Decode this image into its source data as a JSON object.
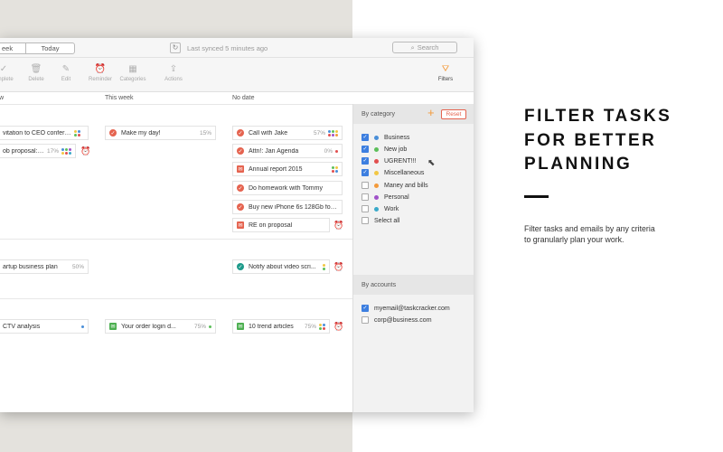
{
  "colors": {
    "accent": "#f39a3b",
    "reset": "#e5634f",
    "check": "#3d7fe0"
  },
  "titlebar": {
    "view_week": "eek",
    "view_today": "Today",
    "sync_icon": "refresh-icon",
    "sync_status": "Last synced 5 minutes ago",
    "search_placeholder": "Search"
  },
  "toolbar": {
    "complete": "omplete",
    "delete": "Delete",
    "edit": "Edit",
    "reminder": "Reminder",
    "categories": "Categories",
    "actions": "Actions",
    "filters": "Filters"
  },
  "columns": {
    "c1": "w",
    "c2": "This week",
    "c3": "No date"
  },
  "cards": [
    {
      "text": "vitation to CEO conference",
      "pct": "",
      "icon": "red"
    },
    {
      "text": "ob proposal: U...",
      "pct": "17%",
      "icon": "red"
    },
    {
      "text": "Make my day!",
      "pct": "15%",
      "icon": "red"
    },
    {
      "text": "Call with Jake",
      "pct": "57%",
      "icon": "red"
    },
    {
      "text": "Attn!: Jan Agenda",
      "pct": "0%",
      "icon": "red"
    },
    {
      "text": "Annual report 2015",
      "pct": "",
      "icon": "mail"
    },
    {
      "text": "Do homework with Tommy",
      "pct": "",
      "icon": "red"
    },
    {
      "text": "Buy new iPhone 6s 128Gb for t...",
      "pct": "",
      "icon": "red"
    },
    {
      "text": "RE on  proposal",
      "pct": "",
      "icon": "mail"
    },
    {
      "text": "artup business plan",
      "pct": "50%",
      "icon": "red"
    },
    {
      "text": "Notify about video scri...",
      "pct": "",
      "icon": "teal"
    },
    {
      "text": "CTV analysis",
      "pct": "",
      "icon": "red"
    },
    {
      "text": "Your order login d...",
      "pct": "75%",
      "icon": "green"
    },
    {
      "text": "10 trend articles",
      "pct": "75%",
      "icon": "green"
    }
  ],
  "filters": {
    "by_category": "By category",
    "reset": "Reset",
    "categories": [
      {
        "label": "Business",
        "color": "#4a8fd8",
        "checked": true
      },
      {
        "label": "New job",
        "color": "#5cbf5a",
        "checked": true
      },
      {
        "label": "UGRENT!!!",
        "color": "#e14f4f",
        "checked": true
      },
      {
        "label": "Miscellaneous",
        "color": "#f2c744",
        "checked": true
      },
      {
        "label": "Maney and bills",
        "color": "#f39a3b",
        "checked": false
      },
      {
        "label": "Personal",
        "color": "#a052c9",
        "checked": false
      },
      {
        "label": "Work",
        "color": "#39a9c9",
        "checked": false
      }
    ],
    "select_all": "Select all",
    "by_accounts": "By accounts",
    "accounts": [
      {
        "label": "myemail@taskcracker.com",
        "checked": true
      },
      {
        "label": "corp@business.com",
        "checked": false
      }
    ]
  },
  "promo": {
    "heading": "FILTER TASKS FOR BETTER PLANNING",
    "body": "Filter tasks and emails by any criteria to granularly plan your work."
  }
}
